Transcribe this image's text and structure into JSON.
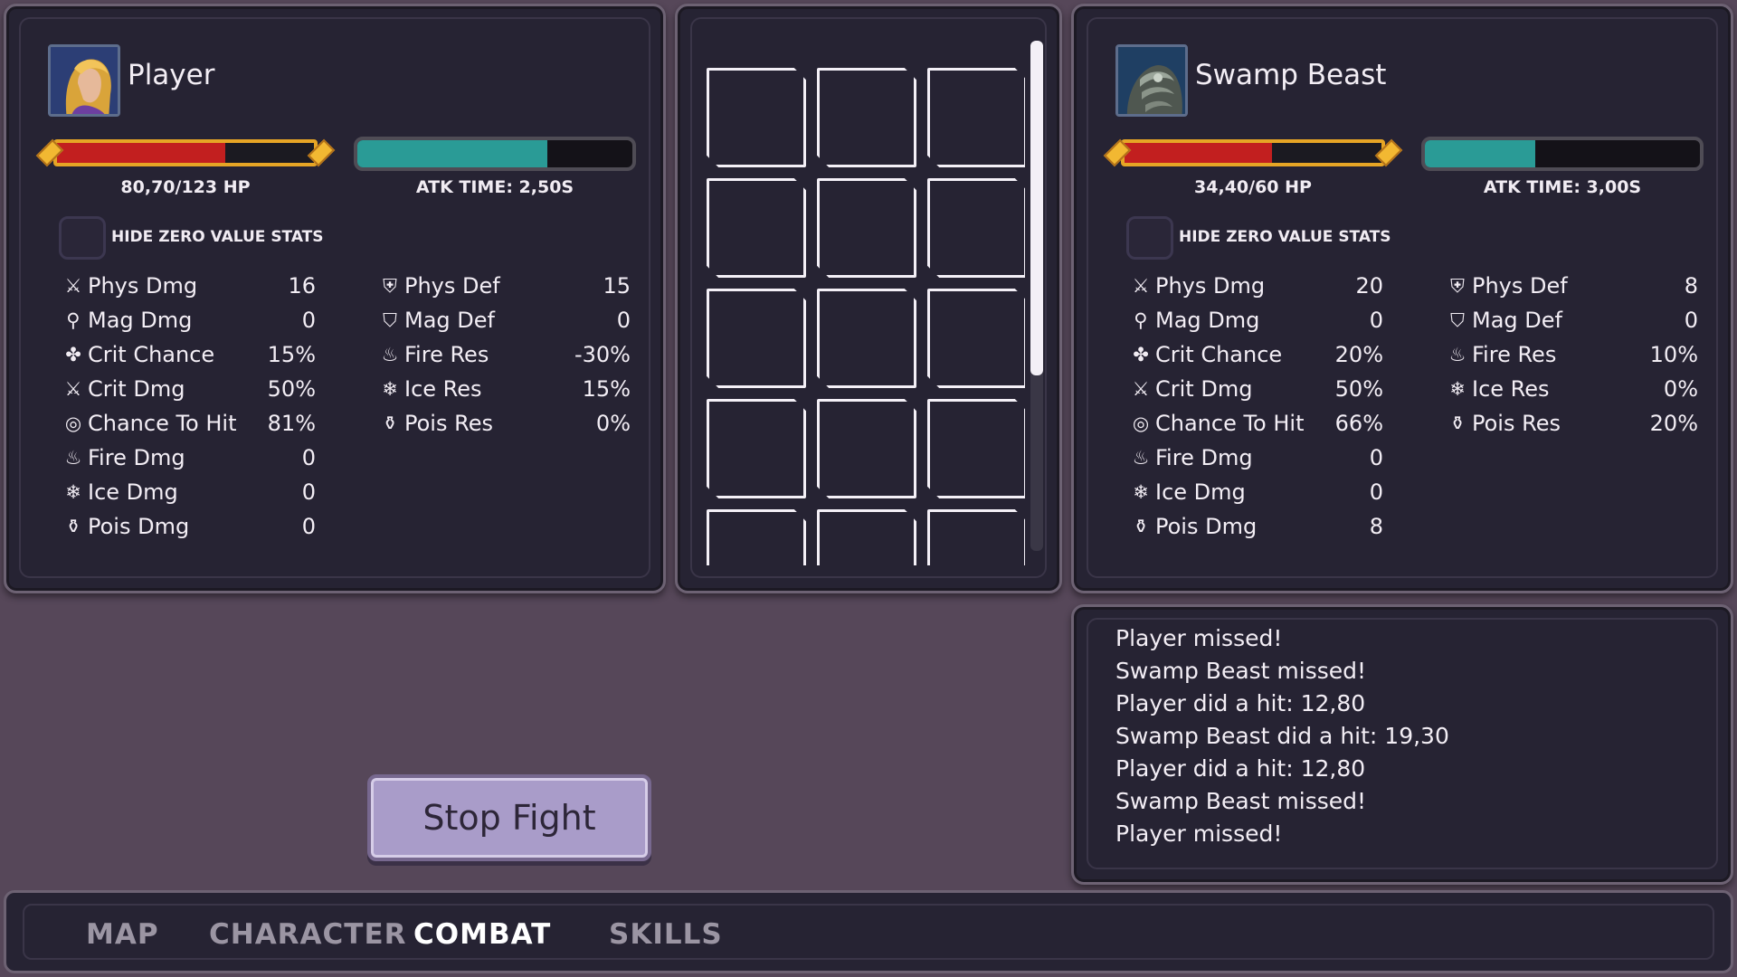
{
  "player": {
    "name": "Player",
    "portrait_icon": "hero-portrait",
    "hp_text": "80,70/123 HP",
    "hp_fraction": 0.656,
    "atk_text": "ATK TIME: 2,50S",
    "atk_fraction": 0.69,
    "hide_zero_label": "HIDE ZERO VALUE STATS",
    "offense_stats": [
      {
        "icon": "swords-icon",
        "name": "Phys Dmg",
        "value": "16"
      },
      {
        "icon": "magic-wand-icon",
        "name": "Mag Dmg",
        "value": "0"
      },
      {
        "icon": "clover-icon",
        "name": "Crit Chance",
        "value": "15%"
      },
      {
        "icon": "dagger-icon",
        "name": "Crit Dmg",
        "value": "50%"
      },
      {
        "icon": "target-icon",
        "name": "Chance To Hit",
        "value": "81%"
      },
      {
        "icon": "flame-icon",
        "name": "Fire Dmg",
        "value": "0"
      },
      {
        "icon": "snowflake-icon",
        "name": "Ice Dmg",
        "value": "0"
      },
      {
        "icon": "potion-icon",
        "name": "Pois Dmg",
        "value": "0"
      }
    ],
    "defense_stats": [
      {
        "icon": "shield-icon",
        "name": "Phys Def",
        "value": "15"
      },
      {
        "icon": "magic-shield-icon",
        "name": "Mag Def",
        "value": "0"
      },
      {
        "icon": "flame-icon",
        "name": "Fire Res",
        "value": "-30%"
      },
      {
        "icon": "snowflake-icon",
        "name": "Ice Res",
        "value": "15%"
      },
      {
        "icon": "potion-icon",
        "name": "Pois Res",
        "value": "0%"
      }
    ]
  },
  "enemy": {
    "name": "Swamp Beast",
    "portrait_icon": "beast-portrait",
    "hp_text": "34,40/60 HP",
    "hp_fraction": 0.573,
    "atk_text": "ATK TIME: 3,00S",
    "atk_fraction": 0.4,
    "hide_zero_label": "HIDE ZERO VALUE STATS",
    "offense_stats": [
      {
        "icon": "swords-icon",
        "name": "Phys Dmg",
        "value": "20"
      },
      {
        "icon": "magic-wand-icon",
        "name": "Mag Dmg",
        "value": "0"
      },
      {
        "icon": "clover-icon",
        "name": "Crit Chance",
        "value": "20%"
      },
      {
        "icon": "dagger-icon",
        "name": "Crit Dmg",
        "value": "50%"
      },
      {
        "icon": "target-icon",
        "name": "Chance To Hit",
        "value": "66%"
      },
      {
        "icon": "flame-icon",
        "name": "Fire Dmg",
        "value": "0"
      },
      {
        "icon": "snowflake-icon",
        "name": "Ice Dmg",
        "value": "0"
      },
      {
        "icon": "potion-icon",
        "name": "Pois Dmg",
        "value": "8"
      }
    ],
    "defense_stats": [
      {
        "icon": "shield-icon",
        "name": "Phys Def",
        "value": "8"
      },
      {
        "icon": "magic-shield-icon",
        "name": "Mag Def",
        "value": "0"
      },
      {
        "icon": "flame-icon",
        "name": "Fire Res",
        "value": "10%"
      },
      {
        "icon": "snowflake-icon",
        "name": "Ice Res",
        "value": "0%"
      },
      {
        "icon": "potion-icon",
        "name": "Pois Res",
        "value": "20%"
      }
    ]
  },
  "inventory": {
    "columns": 3,
    "slot_count": 15
  },
  "combat_log": [
    "Player missed!",
    "Swamp Beast  missed!",
    "Player did a hit: 12,80",
    "Swamp Beast  did a hit: 19,30",
    "Player did a hit: 12,80",
    "Swamp Beast  missed!",
    "Player missed!"
  ],
  "stop_fight_label": "Stop Fight",
  "nav": {
    "tabs": [
      "MAP",
      "CHARACTER",
      "COMBAT",
      "SKILLS"
    ],
    "active": "COMBAT"
  },
  "colors": {
    "hp_fill": "#c21f1f",
    "hp_frame": "#e6a525",
    "atk_fill": "#2a9b96",
    "panel_bg": "#262333",
    "page_bg": "#564759"
  }
}
